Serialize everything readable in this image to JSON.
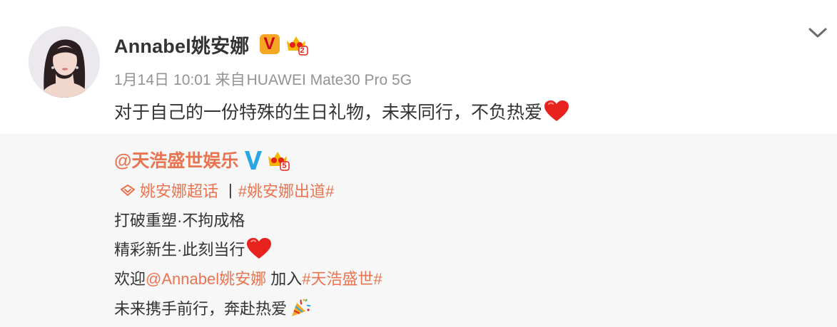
{
  "post": {
    "author": {
      "name": "Annabel姚安娜",
      "verified_badge": "V",
      "verified_color": "#f5a623",
      "level_badge": "2"
    },
    "meta": {
      "date": "1月14日",
      "time": "10:01",
      "source_prefix": "来自",
      "source": "HUAWEI Mate30 Pro 5G"
    },
    "text": "对于自己的一份特殊的生日礼物，未来同行，不负热爱",
    "text_emoji": "heart-emoji"
  },
  "repost": {
    "author": "@天浩盛世娱乐",
    "verified_badge": "V",
    "verified_color": "#2aa6e6",
    "level_badge": "5",
    "super_topic": "姚安娜超话",
    "separator": "|",
    "hashtag": "#姚安娜出道#",
    "line1": "打破重塑·不拘成格",
    "line2": "精彩新生·此刻当行",
    "line3_prefix": "欢迎",
    "line3_mention": "@Annabel姚安娜",
    "line3_middle": " 加入",
    "line3_hashtag": "#天浩盛世#",
    "line4": "未来携手前行，奔赴热爱",
    "line4_emoji": "party-popper-emoji",
    "link_color": "#eb7350"
  }
}
